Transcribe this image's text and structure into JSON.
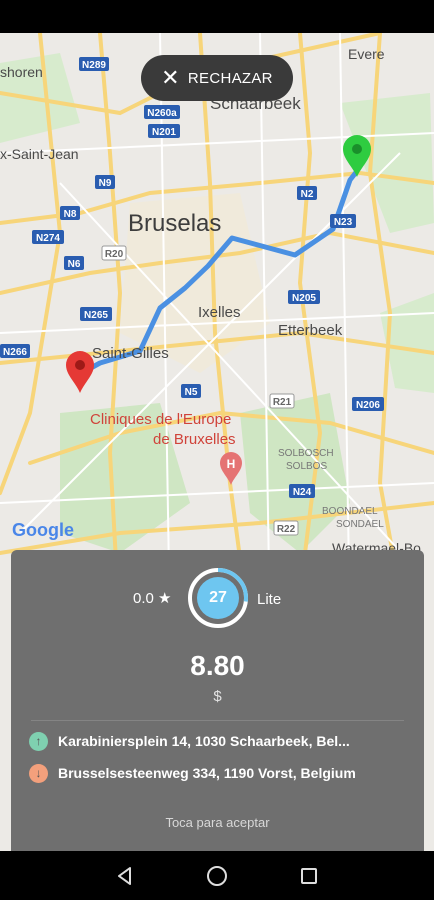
{
  "reject_button": {
    "label": "RECHAZAR"
  },
  "map": {
    "city_label": "Bruselas",
    "places": [
      {
        "name": "Schaarbeek"
      },
      {
        "name": "Evere"
      },
      {
        "name": "Ixelles"
      },
      {
        "name": "Etterbeek"
      },
      {
        "name": "Saint-Gilles"
      },
      {
        "name": "Cliniques de l'Europe"
      },
      {
        "name": "de Bruxelles"
      },
      {
        "name": "shoren"
      },
      {
        "name": "x-Saint-Jean"
      },
      {
        "name": "SOLBOSCH"
      },
      {
        "name": "SOLBOS"
      },
      {
        "name": "BOONDAEL"
      },
      {
        "name": "SONDAEL"
      },
      {
        "name": "Watermael-Bo"
      }
    ],
    "road_shields": [
      "N289",
      "N260a",
      "N201",
      "N9",
      "N8",
      "N274",
      "N6",
      "R20",
      "N265",
      "N266",
      "N2",
      "N23",
      "N205",
      "N5",
      "R21",
      "N206",
      "N24",
      "R22"
    ],
    "google_logo": "Google"
  },
  "card": {
    "rating": "0.0 ★",
    "gauge_value": "27",
    "gauge_fraction": 0.27,
    "tier": "Lite",
    "price": "8.80",
    "currency": "$",
    "pickup_address": "Karabiniersplein 14, 1030 Schaarbeek, Bel...",
    "dropoff_address": "Brusselsesteenweg 334, 1190 Vorst, Belgium",
    "hint": "Toca para aceptar"
  },
  "colors": {
    "route": "#4a90e2",
    "pickup_pin": "#2ecc40",
    "dropoff_pin": "#e53935",
    "pickup_dot": "#7fd0b0",
    "dropoff_dot": "#f3a07c",
    "gauge": "#6ec6f0"
  },
  "icons": [
    "close-icon",
    "star-icon",
    "arrow-up-icon",
    "arrow-down-icon",
    "pin-icon",
    "back-icon",
    "home-icon",
    "recents-icon"
  ]
}
